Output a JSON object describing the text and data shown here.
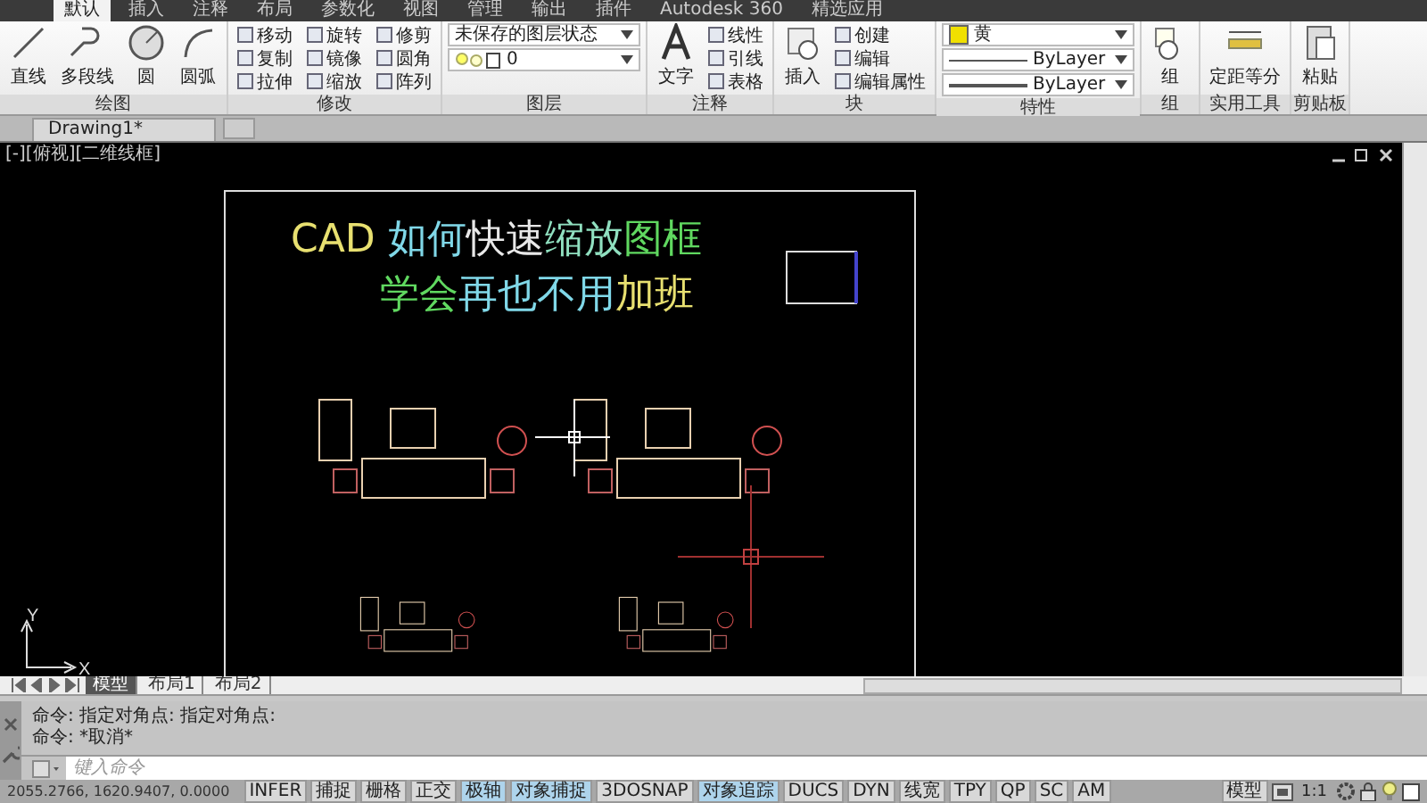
{
  "ribbon_tabs": [
    {
      "label": "默认",
      "selected": true
    },
    {
      "label": "插入",
      "selected": false
    },
    {
      "label": "注释",
      "selected": false
    },
    {
      "label": "布局",
      "selected": false
    },
    {
      "label": "参数化",
      "selected": false
    },
    {
      "label": "视图",
      "selected": false
    },
    {
      "label": "管理",
      "selected": false
    },
    {
      "label": "输出",
      "selected": false
    },
    {
      "label": "插件",
      "selected": false
    },
    {
      "label": "Autodesk 360",
      "selected": false
    },
    {
      "label": "精选应用",
      "selected": false
    }
  ],
  "panels": [
    {
      "title": "绘图",
      "large": [
        {
          "label": "直线",
          "kind": "line"
        },
        {
          "label": "多段线",
          "kind": "polyline"
        },
        {
          "label": "圆",
          "kind": "circle"
        },
        {
          "label": "圆弧",
          "kind": "arc"
        }
      ]
    },
    {
      "title": "修改",
      "small": [
        "移动",
        "复制",
        "拉伸",
        "旋转",
        "镜像",
        "缩放",
        "修剪",
        "圆角",
        "阵列"
      ]
    },
    {
      "title": "图层",
      "dropdowns": [
        {
          "value": "未保存的图层状态",
          "kind": "plain"
        },
        {
          "value": "0",
          "kind": "layer"
        }
      ]
    },
    {
      "title": "注释",
      "large": [
        {
          "label": "文字",
          "kind": "text"
        }
      ],
      "small": [
        "线性",
        "引线",
        "表格"
      ]
    },
    {
      "title": "块",
      "large": [
        {
          "label": "插入",
          "kind": "insert"
        }
      ],
      "small": [
        "创建",
        "编辑",
        "编辑属性"
      ]
    },
    {
      "title": "特性",
      "dropdowns": [
        {
          "value": "黄",
          "kind": "color",
          "color": "#f0e000"
        },
        {
          "value": "ByLayer",
          "kind": "linetype"
        },
        {
          "value": "ByLayer",
          "kind": "lineweight"
        }
      ]
    },
    {
      "title": "组",
      "large": [
        {
          "label": "组",
          "kind": "group"
        }
      ]
    },
    {
      "title": "实用工具",
      "large": [
        {
          "label": "定距等分",
          "kind": "measure"
        }
      ]
    },
    {
      "title": "剪贴板",
      "large": [
        {
          "label": "粘贴",
          "kind": "paste"
        }
      ]
    }
  ],
  "document_tab": "Drawing1*",
  "viewport_label": "[-][俯视][二维线框]",
  "title_lines": [
    {
      "segments": [
        {
          "text": "CAD",
          "color": "#e8e070"
        },
        {
          "text": " 如何",
          "color": "#80d8e8"
        },
        {
          "text": "快速",
          "color": "#e8e8e8"
        },
        {
          "text": "缩放",
          "color": "#90e0c0"
        },
        {
          "text": "图框",
          "color": "#60d860"
        }
      ]
    },
    {
      "segments": [
        {
          "text": "学会",
          "color": "#60d860"
        },
        {
          "text": "再也不用",
          "color": "#80d8e8"
        },
        {
          "text": "加班",
          "color": "#e8e070"
        }
      ]
    }
  ],
  "ucs": {
    "x_label": "X",
    "y_label": "Y"
  },
  "layout_tabs": [
    {
      "label": "模型",
      "selected": true
    },
    {
      "label": "布局1",
      "selected": false
    },
    {
      "label": "布局2",
      "selected": false
    }
  ],
  "command_history": [
    "命令: 指定对角点: 指定对角点:",
    "命令: *取消*"
  ],
  "command_input": {
    "placeholder": "键入命令"
  },
  "coordinates": "2055.2766, 1620.9407, 0.0000",
  "status_toggles": [
    {
      "label": "INFER",
      "on": false
    },
    {
      "label": "捕捉",
      "on": false
    },
    {
      "label": "栅格",
      "on": false
    },
    {
      "label": "正交",
      "on": false
    },
    {
      "label": "极轴",
      "on": true
    },
    {
      "label": "对象捕捉",
      "on": true
    },
    {
      "label": "3DOSNAP",
      "on": false
    },
    {
      "label": "对象追踪",
      "on": true
    },
    {
      "label": "DUCS",
      "on": false
    },
    {
      "label": "DYN",
      "on": false
    },
    {
      "label": "线宽",
      "on": false
    },
    {
      "label": "TPY",
      "on": false
    },
    {
      "label": "QP",
      "on": false
    },
    {
      "label": "SC",
      "on": false
    },
    {
      "label": "AM",
      "on": false
    }
  ],
  "model_button": "模型",
  "scale": "1:1"
}
